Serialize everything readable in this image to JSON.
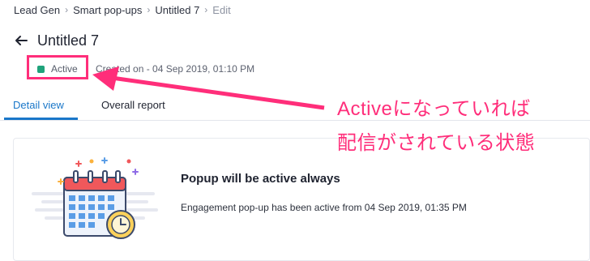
{
  "breadcrumb": {
    "items": [
      "Lead Gen",
      "Smart pop-ups",
      "Untitled 7",
      "Edit"
    ]
  },
  "header": {
    "title": "Untitled 7",
    "status": "Active",
    "created": "Created on - 04 Sep 2019, 01:10 PM"
  },
  "tabs": [
    "Detail view",
    "Overall report"
  ],
  "annotation": {
    "line1": "Activeになっていれば",
    "line2": "配信がされている状態"
  },
  "card": {
    "title": "Popup will be active always",
    "description": "Engagement pop-up has been active from 04 Sep 2019, 01:35 PM"
  },
  "colors": {
    "accent": "#1a77c9",
    "status_active": "#1fa37b",
    "annotation": "#ff2e7a"
  },
  "icons": [
    "back-arrow-icon",
    "chevron-right-icon",
    "calendar-clock-icon"
  ]
}
